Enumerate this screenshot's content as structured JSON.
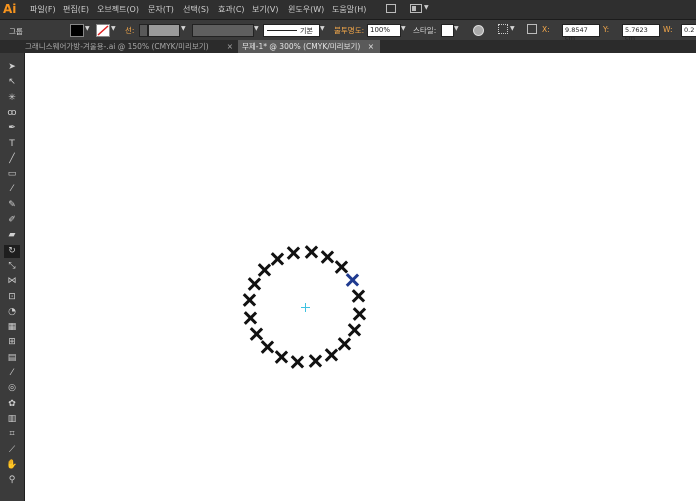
{
  "app": {
    "logo": "Ai"
  },
  "menu": [
    "파일(F)",
    "편집(E)",
    "오브젝트(O)",
    "문자(T)",
    "선택(S)",
    "효과(C)",
    "보기(V)",
    "윈도우(W)",
    "도움말(H)"
  ],
  "control_bar": {
    "group_label": "그룹",
    "stroke_label": "선:",
    "stroke_style": "기본",
    "opacity_label": "불투명도:",
    "opacity_value": "100%",
    "style_label": "스타일:",
    "x_label": "X:",
    "x_value": "9.8547 cm",
    "y_label": "Y:",
    "y_value": "5.7623 cm",
    "w_label": "W:",
    "w_value": "0.2"
  },
  "tabs": [
    {
      "label": "그래니스웨어가방-겨울용-.ai @ 150% (CMYK/미리보기)",
      "close": "×",
      "active": false
    },
    {
      "label": "무제-1* @ 300% (CMYK/미리보기)",
      "close": "×",
      "active": true
    }
  ],
  "tools": [
    "selection-tool",
    "direct-selection-tool",
    "magic-wand-tool",
    "lasso-tool",
    "pen-tool",
    "type-tool",
    "line-tool",
    "rectangle-tool",
    "paintbrush-tool",
    "pencil-tool",
    "blob-brush-tool",
    "eraser-tool",
    "rotate-tool",
    "scale-tool",
    "width-tool",
    "free-transform-tool",
    "shape-builder-tool",
    "perspective-grid-tool",
    "mesh-tool",
    "gradient-tool",
    "eyedropper-tool",
    "blend-tool",
    "symbol-sprayer-tool",
    "column-graph-tool",
    "artboard-tool",
    "slice-tool",
    "hand-tool",
    "zoom-tool"
  ],
  "colors": {
    "accent": "#f7941e",
    "canvas": "#ffffff",
    "mark": "#111111",
    "selection": "#1f3a8f"
  },
  "artwork": {
    "mark_count": 20,
    "selected_index": 4
  }
}
